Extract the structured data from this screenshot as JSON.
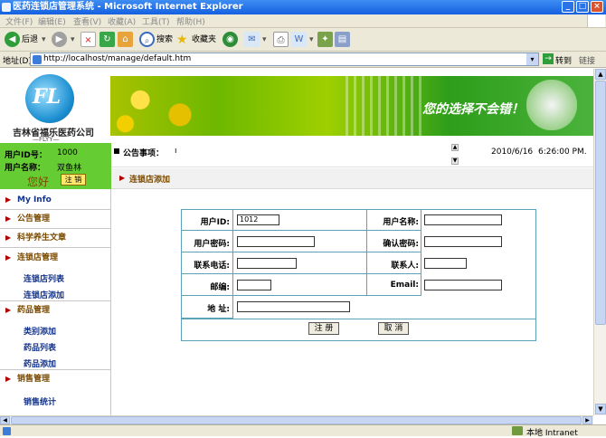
{
  "window": {
    "title": "医药连锁店管理系统 - Microsoft Internet Explorer"
  },
  "menu": [
    "文件(F)",
    "编辑(E)",
    "查看(V)",
    "收藏(A)",
    "工具(T)",
    "帮助(H)"
  ],
  "toolbar": {
    "back": "后退",
    "search": "搜索",
    "favorites": "收藏夹"
  },
  "address": {
    "label": "地址(D)",
    "url": "http://localhost/manage/default.htm",
    "go": "转到",
    "links": "链接"
  },
  "logo": {
    "mark": "FL",
    "company": "吉林省福乐医药公司",
    "sub": "—FLYY—"
  },
  "banner": {
    "slogan": "您的选择不会错！"
  },
  "user": {
    "id_label": "用户ID号：",
    "id_value": "1000",
    "name_label": "用户名称：",
    "name_value": "双鱼林",
    "greeting": "您好",
    "logout": "注 销"
  },
  "sidebar": {
    "sections": [
      {
        "title": "My Info"
      },
      {
        "title": "公告管理"
      },
      {
        "title": "科学养生文章"
      },
      {
        "title": "连锁店管理",
        "items": [
          "连锁店列表",
          "连锁店添加"
        ]
      },
      {
        "title": "药品管理",
        "items": [
          "类别添加",
          "药品列表",
          "药品添加"
        ]
      },
      {
        "title": "销售管理",
        "items": [
          "销售统计"
        ]
      }
    ]
  },
  "notice": {
    "label": "公告事项：",
    "text": "ı",
    "date": "2010/6/16",
    "time": "6:26:00 PM."
  },
  "breadcrumb": "连锁店添加",
  "form": {
    "user_id_label": "用户ID:",
    "user_id_value": "1012",
    "user_name_label": "用户名称:",
    "password_label": "用户密码:",
    "confirm_label": "确认密码:",
    "phone_label": "联系电话:",
    "contact_label": "联系人:",
    "zip_label": "邮编:",
    "email_label": "Email:",
    "address_label": "地 址:",
    "submit": "注 册",
    "cancel": "取 消"
  },
  "status": {
    "zone": "本地 Intranet"
  }
}
